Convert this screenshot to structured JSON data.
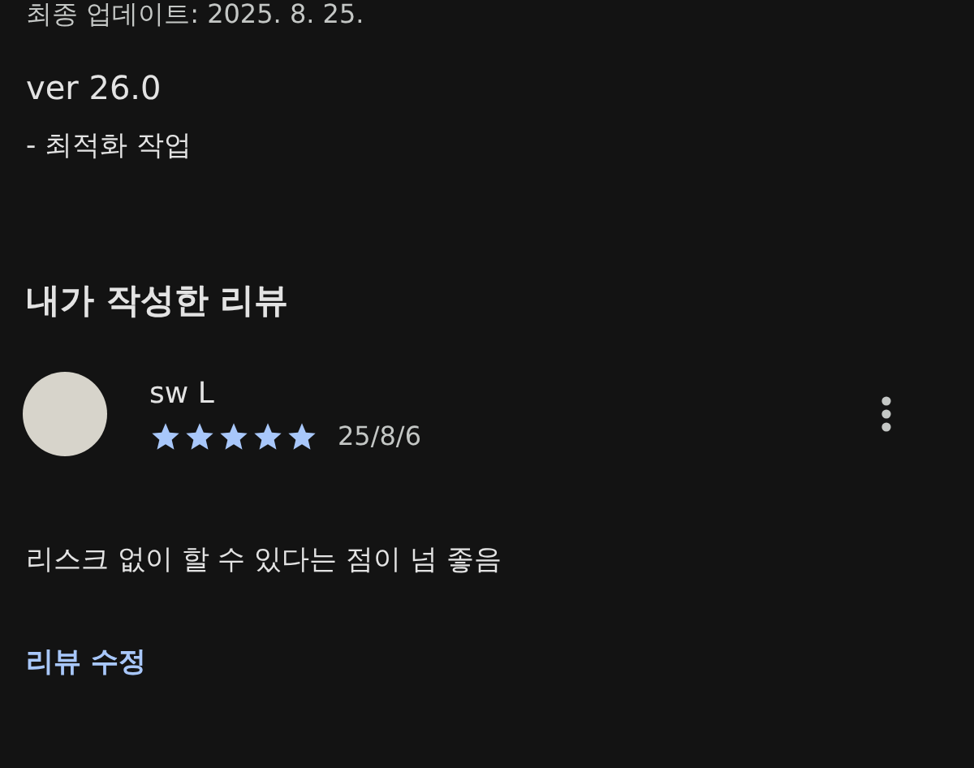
{
  "update_info": {
    "last_updated": "최종 업데이트: 2025. 8. 25."
  },
  "version": {
    "title": "ver 26.0",
    "notes": "- 최적화 작업"
  },
  "my_review": {
    "heading": "내가 작성한 리뷰",
    "review": {
      "author": "sw L",
      "stars": 5,
      "date": "25/8/6",
      "text": "리스크 없이 할 수 있다는 점이 넘 좋음"
    },
    "edit_link": "리뷰 수정"
  }
}
